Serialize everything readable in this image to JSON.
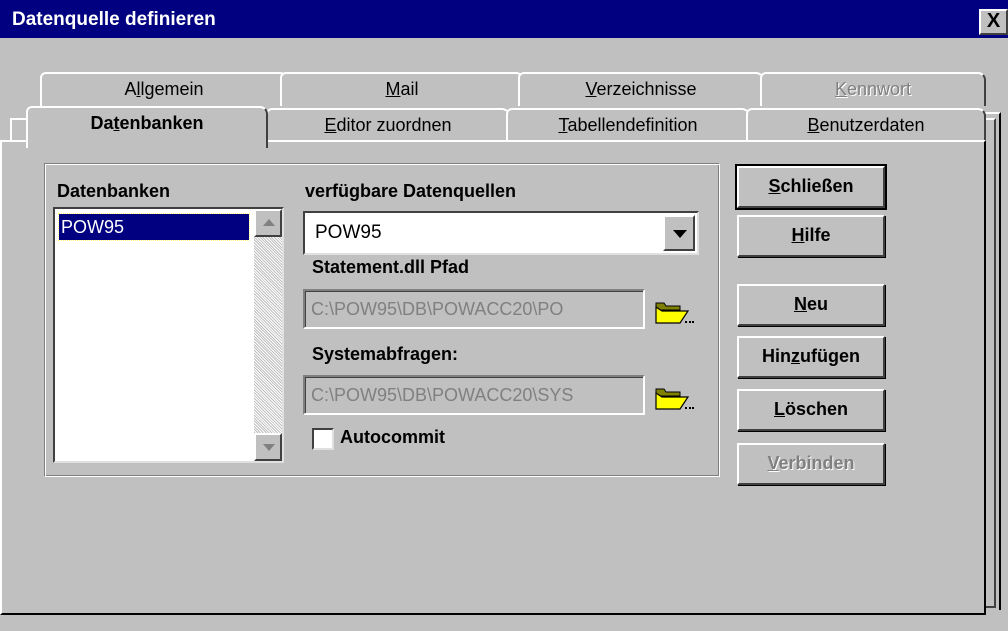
{
  "window": {
    "title": "Datenquelle definieren",
    "close_label": "X"
  },
  "tabs": {
    "row_back": [
      {
        "pre": "A",
        "u": "l",
        "post": "lgemein"
      },
      {
        "pre": "",
        "u": "M",
        "post": "ail"
      },
      {
        "pre": "",
        "u": "V",
        "post": "erzeichnisse"
      },
      {
        "pre": "",
        "u": "K",
        "post": "ennwort"
      }
    ],
    "row_front": [
      {
        "pre": "Da",
        "u": "t",
        "post": "enbanken"
      },
      {
        "pre": "",
        "u": "E",
        "post": "ditor zuordnen"
      },
      {
        "pre": "",
        "u": "T",
        "post": "abellendefinition"
      },
      {
        "pre": "",
        "u": "B",
        "post": "enutzerdaten"
      }
    ]
  },
  "databases": {
    "label": "Datenbanken",
    "items": [
      "POW95"
    ]
  },
  "datasources": {
    "label": "verfügbare Datenquellen",
    "selected": "POW95"
  },
  "statement_dll": {
    "label": "Statement.dll Pfad",
    "value": "C:\\POW95\\DB\\POWACC20\\PO"
  },
  "system_queries": {
    "label": "Systemabfragen:",
    "value": "C:\\POW95\\DB\\POWACC20\\SYS"
  },
  "autocommit": {
    "label": "Autocommit",
    "checked": false
  },
  "buttons": {
    "close": {
      "pre": "",
      "u": "S",
      "post": "chließen"
    },
    "help": {
      "pre": "",
      "u": "H",
      "post": "ilfe"
    },
    "new": {
      "pre": "",
      "u": "N",
      "post": "eu"
    },
    "add": {
      "pre": "Hin",
      "u": "z",
      "post": "ufügen"
    },
    "delete": {
      "pre": "",
      "u": "L",
      "post": "öschen"
    },
    "connect": {
      "pre": "",
      "u": "V",
      "post": "erbinden"
    }
  },
  "icons": {
    "folder": "open-folder-icon",
    "dropdown": "chevron-down-icon",
    "scroll_up": "scroll-up-arrow-icon",
    "scroll_down": "scroll-down-arrow-icon"
  }
}
